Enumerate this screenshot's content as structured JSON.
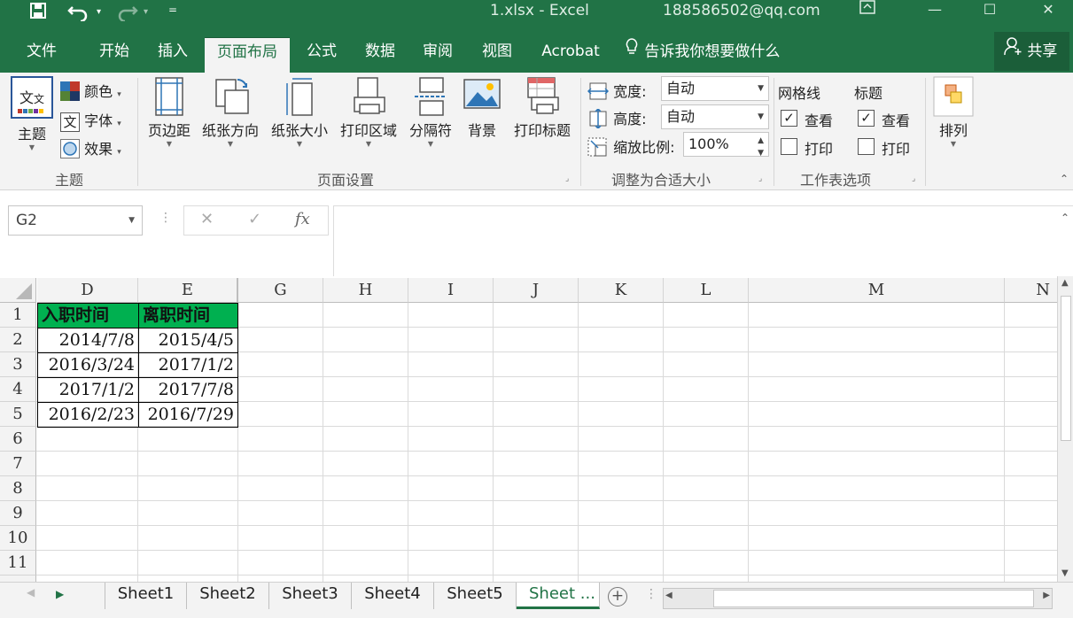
{
  "titlebar": {
    "title": "1.xlsx  -  Excel",
    "account": "188586502@qq.com",
    "save_icon": "save-icon",
    "undo_icon": "undo-icon",
    "redo_icon": "redo-icon"
  },
  "tabs": [
    {
      "label": "文件"
    },
    {
      "label": "开始"
    },
    {
      "label": "插入"
    },
    {
      "label": "页面布局"
    },
    {
      "label": "公式"
    },
    {
      "label": "数据"
    },
    {
      "label": "审阅"
    },
    {
      "label": "视图"
    },
    {
      "label": "Acrobat"
    },
    {
      "label": "告诉我你想要做什么"
    }
  ],
  "share_label": "共享",
  "ribbon": {
    "theme": {
      "theme_label": "主题",
      "colors_label": "颜色",
      "fonts_label": "字体",
      "effects_label": "效果",
      "fonts_icon_char": "文",
      "group_label": "主题"
    },
    "page_setup": {
      "margins": "页边距",
      "orientation": "纸张方向",
      "size": "纸张大小",
      "print_area": "打印区域",
      "breaks": "分隔符",
      "background": "背景",
      "print_titles": "打印标题",
      "group_label": "页面设置"
    },
    "scale": {
      "width_label": "宽度:",
      "width_value": "自动",
      "height_label": "高度:",
      "height_value": "自动",
      "scale_label": "缩放比例:",
      "scale_value": "100%",
      "group_label": "调整为合适大小"
    },
    "sheet_options": {
      "gridlines_label": "网格线",
      "headings_label": "标题",
      "view_label": "查看",
      "print_label": "打印",
      "gridlines_view": true,
      "gridlines_print": false,
      "headings_view": true,
      "headings_print": false,
      "group_label": "工作表选项"
    },
    "arrange_label": "排列"
  },
  "formula_bar": {
    "name_box": "G2",
    "cancel": "✕",
    "enter": "✓",
    "fx": "fx",
    "formula": ""
  },
  "columns": [
    "D",
    "E",
    "G",
    "H",
    "I",
    "J",
    "K",
    "L",
    "M",
    "N"
  ],
  "rows": [
    "1",
    "2",
    "3",
    "4",
    "5",
    "6",
    "7",
    "8",
    "9",
    "10",
    "11"
  ],
  "table": {
    "headers": [
      "入职时间",
      "离职时间"
    ],
    "rows": [
      [
        "2014/7/8",
        "2015/4/5"
      ],
      [
        "2016/3/24",
        "2017/1/2"
      ],
      [
        "2017/1/2",
        "2017/7/8"
      ],
      [
        "2016/2/23",
        "2016/7/29"
      ]
    ]
  },
  "sheet_tabs": [
    "Sheet1",
    "Sheet2",
    "Sheet3",
    "Sheet4",
    "Sheet5",
    "Sheet ..."
  ],
  "active_sheet": "Sheet ...",
  "colors": {
    "excel_green": "#217346",
    "header_fill": "#00b050"
  }
}
